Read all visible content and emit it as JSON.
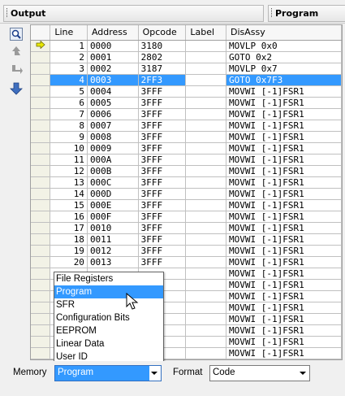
{
  "tabs": {
    "output": "Output",
    "program": "Program"
  },
  "toolbar": [
    "zoom-icon",
    "step-back-icon",
    "step-over-icon",
    "download-icon"
  ],
  "grid": {
    "columns": [
      "",
      "Line",
      "Address",
      "Opcode",
      "Label",
      "DisAssy"
    ],
    "selected_line": "4",
    "current_line": "1",
    "rows": [
      [
        "1",
        "0000",
        "3180",
        "",
        "MOVLP 0x0"
      ],
      [
        "2",
        "0001",
        "2802",
        "",
        "GOTO 0x2"
      ],
      [
        "3",
        "0002",
        "3187",
        "",
        "MOVLP 0x7"
      ],
      [
        "4",
        "0003",
        "2FF3",
        "",
        "GOTO 0x7F3"
      ],
      [
        "5",
        "0004",
        "3FFF",
        "",
        "MOVWI [-1]FSR1"
      ],
      [
        "6",
        "0005",
        "3FFF",
        "",
        "MOVWI [-1]FSR1"
      ],
      [
        "7",
        "0006",
        "3FFF",
        "",
        "MOVWI [-1]FSR1"
      ],
      [
        "8",
        "0007",
        "3FFF",
        "",
        "MOVWI [-1]FSR1"
      ],
      [
        "9",
        "0008",
        "3FFF",
        "",
        "MOVWI [-1]FSR1"
      ],
      [
        "10",
        "0009",
        "3FFF",
        "",
        "MOVWI [-1]FSR1"
      ],
      [
        "11",
        "000A",
        "3FFF",
        "",
        "MOVWI [-1]FSR1"
      ],
      [
        "12",
        "000B",
        "3FFF",
        "",
        "MOVWI [-1]FSR1"
      ],
      [
        "13",
        "000C",
        "3FFF",
        "",
        "MOVWI [-1]FSR1"
      ],
      [
        "14",
        "000D",
        "3FFF",
        "",
        "MOVWI [-1]FSR1"
      ],
      [
        "15",
        "000E",
        "3FFF",
        "",
        "MOVWI [-1]FSR1"
      ],
      [
        "16",
        "000F",
        "3FFF",
        "",
        "MOVWI [-1]FSR1"
      ],
      [
        "17",
        "0010",
        "3FFF",
        "",
        "MOVWI [-1]FSR1"
      ],
      [
        "18",
        "0011",
        "3FFF",
        "",
        "MOVWI [-1]FSR1"
      ],
      [
        "19",
        "0012",
        "3FFF",
        "",
        "MOVWI [-1]FSR1"
      ],
      [
        "20",
        "0013",
        "3FFF",
        "",
        "MOVWI [-1]FSR1"
      ],
      [
        "",
        "",
        "",
        "",
        "MOVWI [-1]FSR1"
      ],
      [
        "",
        "",
        "",
        "",
        "MOVWI [-1]FSR1"
      ],
      [
        "",
        "",
        "",
        "",
        "MOVWI [-1]FSR1"
      ],
      [
        "",
        "",
        "",
        "",
        "MOVWI [-1]FSR1"
      ],
      [
        "",
        "",
        "",
        "",
        "MOVWI [-1]FSR1"
      ],
      [
        "",
        "",
        "",
        "",
        "MOVWI [-1]FSR1"
      ],
      [
        "",
        "",
        "",
        "",
        "MOVWI [-1]FSR1"
      ],
      [
        "",
        "",
        "",
        "",
        "MOVWI [-1]FSR1"
      ]
    ]
  },
  "memory_dropdown": {
    "label": "Memory",
    "value": "Program",
    "highlighted": "Program",
    "options": [
      "File Registers",
      "Program",
      "SFR",
      "Configuration Bits",
      "EEPROM",
      "Linear Data",
      "User ID"
    ]
  },
  "format_dropdown": {
    "label": "Format",
    "value": "Code"
  },
  "colors": {
    "selection": "#3399ff",
    "marker_arrow": "#e8e800"
  }
}
